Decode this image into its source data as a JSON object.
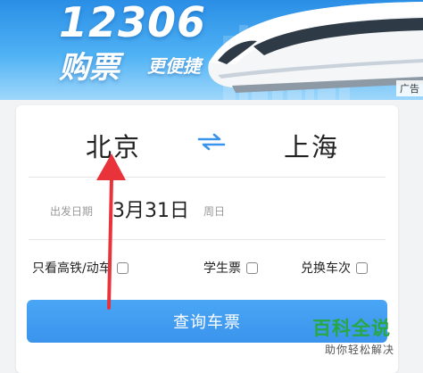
{
  "banner": {
    "number": "12306",
    "slogan_main": "购票",
    "slogan_sub": "更便捷",
    "ad_tag": "广告"
  },
  "stations": {
    "from": "北京",
    "to": "上海",
    "swap_icon": "swap-arrows-icon"
  },
  "date": {
    "label": "出发日期",
    "value": "3月31日",
    "weekday": "周日"
  },
  "options": [
    {
      "label": "只看高铁/动车",
      "checked": false
    },
    {
      "label": "学生票",
      "checked": false
    },
    {
      "label": "兑换车次",
      "checked": false
    }
  ],
  "search_button": "查询车票",
  "watermark": {
    "title": "百科全说",
    "subtitle": "助你轻松解决"
  },
  "colors": {
    "primary": "#3a94ec",
    "annotation": "#e8333a",
    "watermark_green": "#27a844"
  }
}
